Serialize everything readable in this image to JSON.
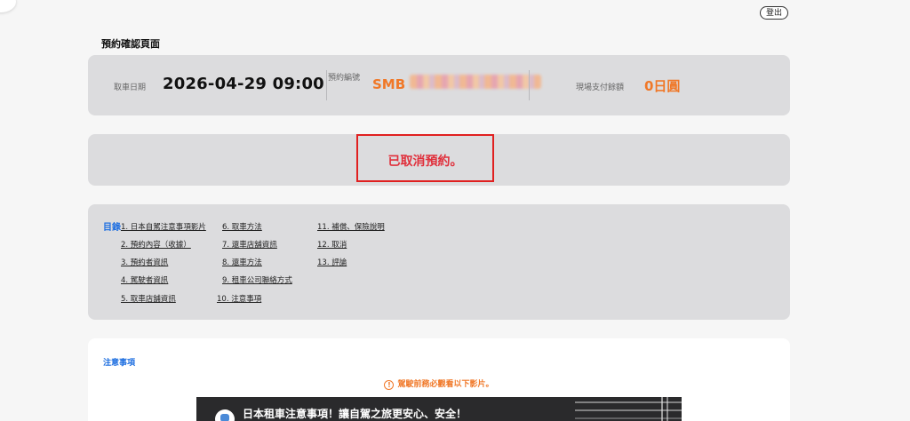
{
  "header": {
    "logout_label": "登出"
  },
  "page": {
    "title": "預約確認頁面"
  },
  "booking": {
    "pickup_date_label": "取車日期",
    "pickup_datetime": "2026-04-29 09:00",
    "booking_no_label": "預約編號",
    "booking_no_prefix": "SMB",
    "onsite_payment_label": "現場支付餘額",
    "onsite_payment_value": "0日圓"
  },
  "status": {
    "message": "已取消預約。"
  },
  "toc": {
    "heading": "目錄",
    "items": [
      "1. 日本自駕注意事項影片",
      "2. 預約內容（收據）",
      "3. 預約者資訊",
      "4. 駕駛者資訊",
      "5. 取車店舖資訊",
      "6. 取車方法",
      "7. 還車店舖資訊",
      "8. 還車方法",
      "9. 租車公司聯絡方式",
      "10. 注意事項",
      "11. 補償、保險說明",
      "12. 取消",
      "13. 評論"
    ]
  },
  "notice": {
    "heading": "注意事項",
    "warning": "駕駛前務必觀看以下影片。",
    "video_title": "日本租車注意事項！讓自駕之旅更安心、安全！"
  },
  "colors": {
    "accent_orange": "#f07828",
    "link_blue": "#1f6fe0",
    "alert_red": "#e0303c"
  }
}
